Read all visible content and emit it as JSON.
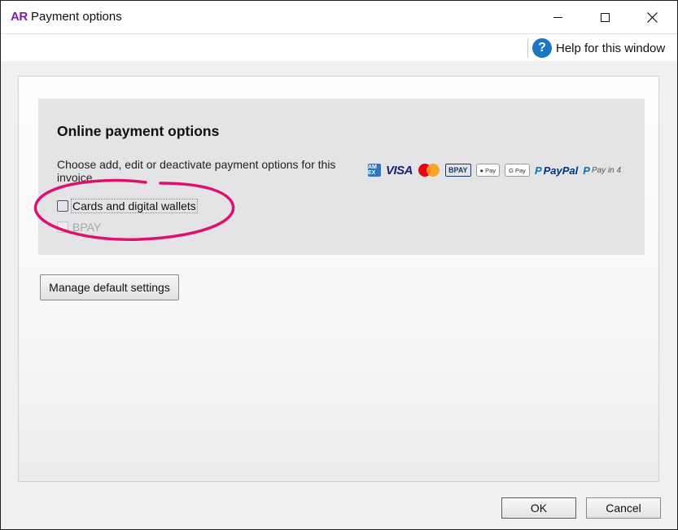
{
  "window": {
    "app_logo": "AR",
    "title": "Payment options",
    "controls": {
      "minimize": "minimize",
      "maximize": "maximize",
      "close": "✕"
    }
  },
  "help": {
    "icon": "?",
    "label": "Help for this window"
  },
  "online_payment": {
    "title": "Online payment options",
    "description": "Choose add, edit or deactivate payment options for this invoice",
    "options": [
      {
        "label": "Cards and digital wallets",
        "checked": false,
        "enabled": true
      },
      {
        "label": "BPAY",
        "checked": false,
        "enabled": false
      }
    ],
    "logos": {
      "amex": "AM EX",
      "visa": "VISA",
      "bpay": "BPAY",
      "apple_pay": "Pay",
      "google_pay": "G Pay",
      "paypal": "PayPal",
      "pay_in_4": "Pay in 4"
    }
  },
  "manage_button": "Manage default settings",
  "footer": {
    "ok": "OK",
    "cancel": "Cancel"
  },
  "colors": {
    "app_logo": "#7b1fa2",
    "help_icon": "#1b76c4",
    "annotation": "#e0106e",
    "online_box": "#e4e4e6"
  }
}
